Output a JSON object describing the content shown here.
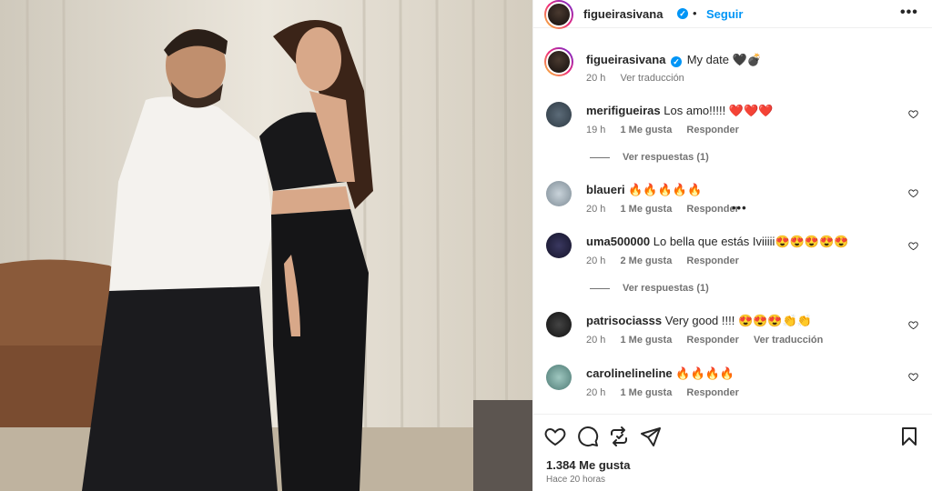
{
  "post": {
    "username": "figueirasivana",
    "follow_label": "Seguir",
    "separator": "•",
    "more_label": "•••",
    "caption": "My date",
    "caption_emoji": "🖤💣",
    "caption_time": "20 h",
    "caption_translate": "Ver traducción",
    "likes": "1.384 Me gusta",
    "time_ago": "Hace 20 horas"
  },
  "comments": [
    {
      "username": "merifigueiras",
      "text": "Los amo!!!!!",
      "emoji": "❤️❤️❤️",
      "time": "19 h",
      "likes": "1 Me gusta",
      "reply": "Responder",
      "translate": "",
      "view_replies": "Ver respuestas (1)"
    },
    {
      "username": "blaueri",
      "text": "",
      "emoji": "🔥🔥🔥🔥🔥",
      "time": "20 h",
      "likes": "1 Me gusta",
      "reply": "Responder",
      "translate": "",
      "more": "•••",
      "view_replies": ""
    },
    {
      "username": "uma500000",
      "text": "Lo bella que estás Iviiiii",
      "emoji": "😍😍😍😍😍",
      "time": "20 h",
      "likes": "2 Me gusta",
      "reply": "Responder",
      "translate": "",
      "view_replies": "Ver respuestas (1)"
    },
    {
      "username": "patrisociasss",
      "text": "Very good !!!!",
      "emoji": "😍😍😍👏👏",
      "time": "20 h",
      "likes": "1 Me gusta",
      "reply": "Responder",
      "translate": "Ver traducción",
      "view_replies": ""
    },
    {
      "username": "carolinelineline",
      "text": "",
      "emoji": "🔥🔥🔥🔥",
      "time": "20 h",
      "likes": "1 Me gusta",
      "reply": "Responder",
      "translate": "",
      "view_replies": ""
    }
  ],
  "icons": {
    "like": "heart-icon",
    "comment": "comment-icon",
    "share": "repost-icon",
    "send": "send-icon",
    "save": "bookmark-icon"
  },
  "colors": {
    "accent": "#0095f6",
    "muted": "#737373",
    "text": "#262626"
  }
}
